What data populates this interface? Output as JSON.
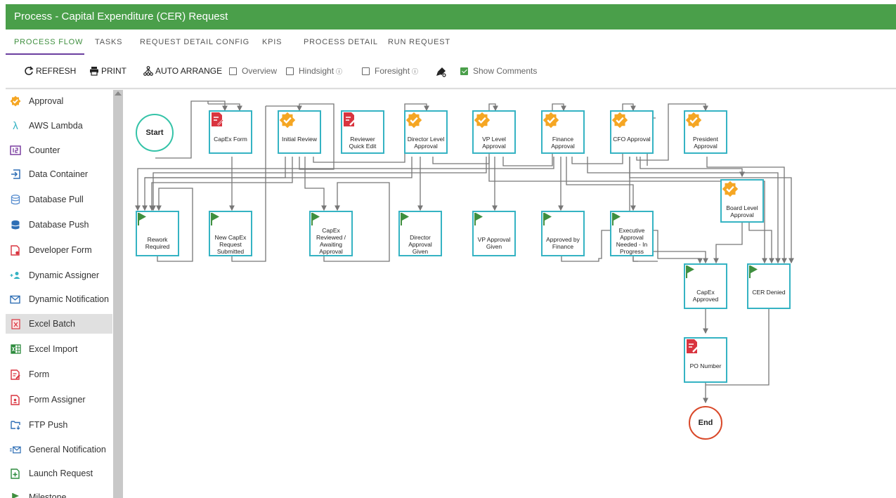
{
  "header": {
    "title": "Process - Capital Expenditure (CER) Request"
  },
  "tabs": [
    {
      "label": "PROCESS FLOW",
      "active": true
    },
    {
      "label": "TASKS"
    },
    {
      "label": "REQUEST DETAIL CONFIG"
    },
    {
      "label": "KPIS"
    },
    {
      "label": "PROCESS DETAIL"
    },
    {
      "label": "RUN REQUEST"
    }
  ],
  "toolbar": {
    "refresh": "REFRESH",
    "print": "PRINT",
    "auto_arrange": "AUTO ARRANGE",
    "overview": "Overview",
    "hindsight": "Hindsight",
    "foresight": "Foresight",
    "show_comments": "Show Comments",
    "show_comments_checked": true
  },
  "sidebar": {
    "items": [
      {
        "label": "Approval",
        "icon": "badge-check-icon"
      },
      {
        "label": "AWS Lambda",
        "icon": "lambda-icon"
      },
      {
        "label": "Counter",
        "icon": "counter-icon"
      },
      {
        "label": "Data Container",
        "icon": "data-container-icon"
      },
      {
        "label": "Database Pull",
        "icon": "database-pull-icon"
      },
      {
        "label": "Database Push",
        "icon": "database-push-icon"
      },
      {
        "label": "Developer Form",
        "icon": "developer-form-icon"
      },
      {
        "label": "Dynamic Assigner",
        "icon": "dynamic-assigner-icon"
      },
      {
        "label": "Dynamic Notification",
        "icon": "mail-icon"
      },
      {
        "label": "Excel Batch",
        "icon": "excel-batch-icon",
        "selected": true
      },
      {
        "label": "Excel Import",
        "icon": "excel-import-icon"
      },
      {
        "label": "Form",
        "icon": "form-icon"
      },
      {
        "label": "Form Assigner",
        "icon": "form-assigner-icon"
      },
      {
        "label": "FTP Push",
        "icon": "ftp-push-icon"
      },
      {
        "label": "General Notification",
        "icon": "general-notification-icon"
      },
      {
        "label": "Launch Request",
        "icon": "launch-request-icon"
      },
      {
        "label": "Milestone",
        "icon": "milestone-icon"
      }
    ]
  },
  "flow": {
    "start": "Start",
    "end": "End",
    "nodes": [
      {
        "id": "capex-form",
        "label": "CapEx Form",
        "icon": "form-icon"
      },
      {
        "id": "initial-review",
        "label": "Initial Review",
        "icon": "badge-check-icon"
      },
      {
        "id": "reviewer-quick-edit",
        "label": "Reviewer Quick Edit",
        "icon": "form-icon"
      },
      {
        "id": "director-level-approval",
        "label": "Director Level Approval",
        "icon": "badge-check-icon"
      },
      {
        "id": "vp-level-approval",
        "label": "VP Level Approval",
        "icon": "badge-check-icon"
      },
      {
        "id": "finance-approval",
        "label": "Finance Approval",
        "icon": "badge-check-icon"
      },
      {
        "id": "cfo-approval",
        "label": "CFO Approval",
        "icon": "badge-check-icon"
      },
      {
        "id": "president-approval",
        "label": "President Approval",
        "icon": "badge-check-icon"
      },
      {
        "id": "board-level-approval",
        "label": "Board Level Approval",
        "icon": "badge-check-icon"
      },
      {
        "id": "rework-required",
        "label": "Rework Required",
        "icon": "flag-icon"
      },
      {
        "id": "new-capex-request-submitted",
        "label": "New CapEx Request Submitted",
        "icon": "flag-icon"
      },
      {
        "id": "capex-reviewed-awaiting-approval",
        "label": "CapEx Reviewed / Awaiting Approval",
        "icon": "flag-icon"
      },
      {
        "id": "director-approval-given",
        "label": "Director Approval Given",
        "icon": "flag-icon"
      },
      {
        "id": "vp-approval-given",
        "label": "VP Approval Given",
        "icon": "flag-icon"
      },
      {
        "id": "approved-by-finance",
        "label": "Approved by Finance",
        "icon": "flag-icon"
      },
      {
        "id": "executive-approval-needed",
        "label": "Executive Approval Needed - In Progress",
        "icon": "flag-icon"
      },
      {
        "id": "capex-approved",
        "label": "CapEx Approved",
        "icon": "flag-icon"
      },
      {
        "id": "cer-denied",
        "label": "CER Denied",
        "icon": "flag-icon"
      },
      {
        "id": "po-number",
        "label": "PO Number",
        "icon": "form-icon"
      }
    ]
  },
  "colors": {
    "header": "#4a9f4a",
    "node_border": "#35b3c3",
    "start": "#35c3a8",
    "end": "#d9492a",
    "approval_badge": "#f5a623",
    "form_icon": "#d9343f",
    "flag": "#3f8f3f",
    "connector": "#777777"
  }
}
